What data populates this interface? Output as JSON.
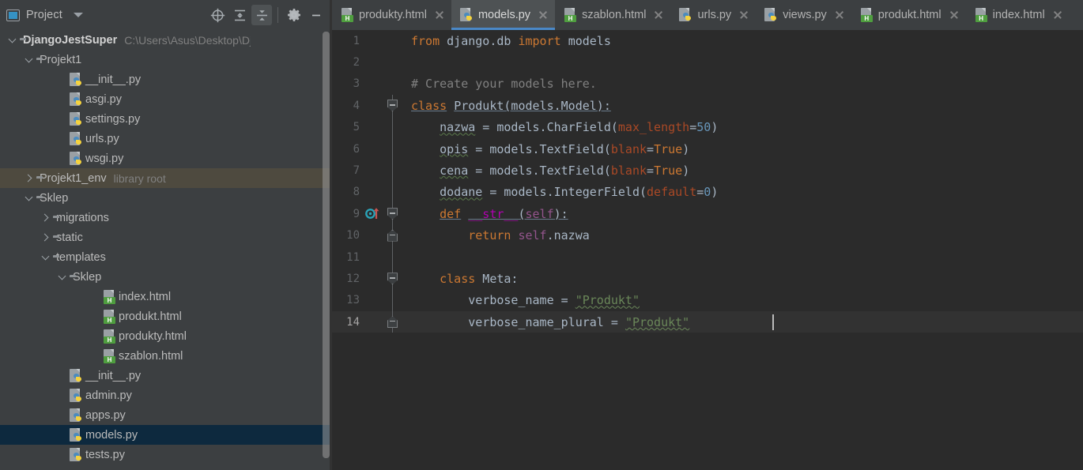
{
  "window": {
    "tool_window_title": "Project"
  },
  "toolbar": {
    "buttons": [
      {
        "name": "scroll-from-source-icon",
        "label": "Select Opened File"
      },
      {
        "name": "expand-all-icon",
        "label": "Expand All"
      },
      {
        "name": "collapse-all-icon",
        "label": "Collapse All"
      },
      {
        "name": "gear-icon",
        "label": "Options"
      },
      {
        "name": "minimize-icon",
        "label": "Hide"
      }
    ]
  },
  "tabs": [
    {
      "label": "produkty.html",
      "icon": "html-file-icon",
      "active": false
    },
    {
      "label": "models.py",
      "icon": "python-file-icon",
      "active": true
    },
    {
      "label": "szablon.html",
      "icon": "html-file-icon",
      "active": false
    },
    {
      "label": "urls.py",
      "icon": "python-file-icon",
      "active": false
    },
    {
      "label": "views.py",
      "icon": "python-file-icon",
      "active": false
    },
    {
      "label": "produkt.html",
      "icon": "html-file-icon",
      "active": false
    },
    {
      "label": "index.html",
      "icon": "html-file-icon",
      "active": false
    }
  ],
  "tree": [
    {
      "label": "DjangoJestSuper",
      "sub": "C:\\Users\\Asus\\Desktop\\DjangoJestSup",
      "indent": 0,
      "arrow": "down",
      "icon": "folder-icon",
      "bold": true,
      "state": "normal"
    },
    {
      "label": "Projekt1",
      "sub": "",
      "indent": 1,
      "arrow": "down",
      "icon": "folder-source-icon",
      "bold": false,
      "state": "normal"
    },
    {
      "label": "__init__.py",
      "sub": "",
      "indent": 3,
      "arrow": "none",
      "icon": "python-file-icon",
      "bold": false,
      "state": "normal"
    },
    {
      "label": "asgi.py",
      "sub": "",
      "indent": 3,
      "arrow": "none",
      "icon": "python-file-icon",
      "bold": false,
      "state": "normal"
    },
    {
      "label": "settings.py",
      "sub": "",
      "indent": 3,
      "arrow": "none",
      "icon": "python-file-icon",
      "bold": false,
      "state": "normal"
    },
    {
      "label": "urls.py",
      "sub": "",
      "indent": 3,
      "arrow": "none",
      "icon": "python-file-icon",
      "bold": false,
      "state": "normal"
    },
    {
      "label": "wsgi.py",
      "sub": "",
      "indent": 3,
      "arrow": "none",
      "icon": "python-file-icon",
      "bold": false,
      "state": "normal"
    },
    {
      "label": "Projekt1_env",
      "sub": "library root",
      "indent": 1,
      "arrow": "right",
      "icon": "folder-icon",
      "bold": false,
      "state": "highlight"
    },
    {
      "label": "Sklep",
      "sub": "",
      "indent": 1,
      "arrow": "down",
      "icon": "folder-source-icon",
      "bold": false,
      "state": "normal"
    },
    {
      "label": "migrations",
      "sub": "",
      "indent": 2,
      "arrow": "right",
      "icon": "folder-source-icon",
      "bold": false,
      "state": "normal"
    },
    {
      "label": "static",
      "sub": "",
      "indent": 2,
      "arrow": "right",
      "icon": "folder-icon",
      "bold": false,
      "state": "normal"
    },
    {
      "label": "templates",
      "sub": "",
      "indent": 2,
      "arrow": "down",
      "icon": "folder-icon",
      "bold": false,
      "state": "normal"
    },
    {
      "label": "Sklep",
      "sub": "",
      "indent": 3,
      "arrow": "down",
      "icon": "folder-icon",
      "bold": false,
      "state": "normal"
    },
    {
      "label": "index.html",
      "sub": "",
      "indent": 5,
      "arrow": "none",
      "icon": "html-file-icon",
      "bold": false,
      "state": "normal"
    },
    {
      "label": "produkt.html",
      "sub": "",
      "indent": 5,
      "arrow": "none",
      "icon": "html-file-icon",
      "bold": false,
      "state": "normal"
    },
    {
      "label": "produkty.html",
      "sub": "",
      "indent": 5,
      "arrow": "none",
      "icon": "html-file-icon",
      "bold": false,
      "state": "normal"
    },
    {
      "label": "szablon.html",
      "sub": "",
      "indent": 5,
      "arrow": "none",
      "icon": "html-file-icon",
      "bold": false,
      "state": "normal"
    },
    {
      "label": "__init__.py",
      "sub": "",
      "indent": 3,
      "arrow": "none",
      "icon": "python-file-icon",
      "bold": false,
      "state": "normal"
    },
    {
      "label": "admin.py",
      "sub": "",
      "indent": 3,
      "arrow": "none",
      "icon": "python-file-icon",
      "bold": false,
      "state": "normal"
    },
    {
      "label": "apps.py",
      "sub": "",
      "indent": 3,
      "arrow": "none",
      "icon": "python-file-icon",
      "bold": false,
      "state": "normal"
    },
    {
      "label": "models.py",
      "sub": "",
      "indent": 3,
      "arrow": "none",
      "icon": "python-file-icon",
      "bold": false,
      "state": "selected"
    },
    {
      "label": "tests.py",
      "sub": "",
      "indent": 3,
      "arrow": "none",
      "icon": "python-file-icon",
      "bold": false,
      "state": "normal"
    }
  ],
  "editor": {
    "file": "models.py",
    "current_line": 14,
    "line_numbers": [
      "1",
      "2",
      "3",
      "4",
      "5",
      "6",
      "7",
      "8",
      "9",
      "10",
      "11",
      "12",
      "13",
      "14"
    ],
    "lines": [
      {
        "n": "1",
        "text": "from django.db import models"
      },
      {
        "n": "2",
        "text": ""
      },
      {
        "n": "3",
        "text": "# Create your models here."
      },
      {
        "n": "4",
        "text": "class Produkt(models.Model):"
      },
      {
        "n": "5",
        "text": "    nazwa = models.CharField(max_length=50)"
      },
      {
        "n": "6",
        "text": "    opis = models.TextField(blank=True)"
      },
      {
        "n": "7",
        "text": "    cena = models.TextField(blank=True)"
      },
      {
        "n": "8",
        "text": "    dodane = models.IntegerField(default=0)"
      },
      {
        "n": "9",
        "text": "    def __str__(self):"
      },
      {
        "n": "10",
        "text": "        return self.nazwa"
      },
      {
        "n": "11",
        "text": ""
      },
      {
        "n": "12",
        "text": "    class Meta:"
      },
      {
        "n": "13",
        "text": "        verbose_name = \"Produkt\""
      },
      {
        "n": "14",
        "text": "        verbose_name_plural = \"Produkt\""
      }
    ],
    "gutter_icons": [
      {
        "line": "9",
        "name": "overrides-method-icon"
      }
    ]
  },
  "colors": {
    "tool_window_bg": "#3c3f41",
    "editor_bg": "#2b2b2b",
    "selection_blue": "#0d293e",
    "accent_blue": "#4a88c7",
    "highlight_olive": "#4e4a3f",
    "keyword_orange": "#cc7832",
    "string_green": "#6a8759",
    "number_blue": "#6897bb",
    "comment_gray": "#808080",
    "text_gray": "#a9b7c6",
    "kwarg_rust": "#aa4926",
    "magenta": "#b200b2",
    "self_purple": "#94558d"
  }
}
